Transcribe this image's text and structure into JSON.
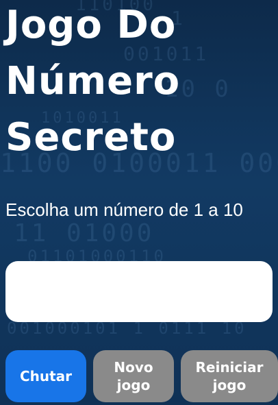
{
  "title": {
    "line1": "Jogo Do",
    "line2": "Número",
    "line3": "Secreto"
  },
  "instruction": "Escolha um número de 1 a 10",
  "input": {
    "value": "",
    "placeholder": ""
  },
  "buttons": {
    "guess_label": "Chutar",
    "new_game_label": "Novo jogo",
    "restart_label": "Reiniciar jogo"
  },
  "colors": {
    "background": "#123a63",
    "primary_button": "#1875e8",
    "secondary_button": "#8a8a8a"
  }
}
